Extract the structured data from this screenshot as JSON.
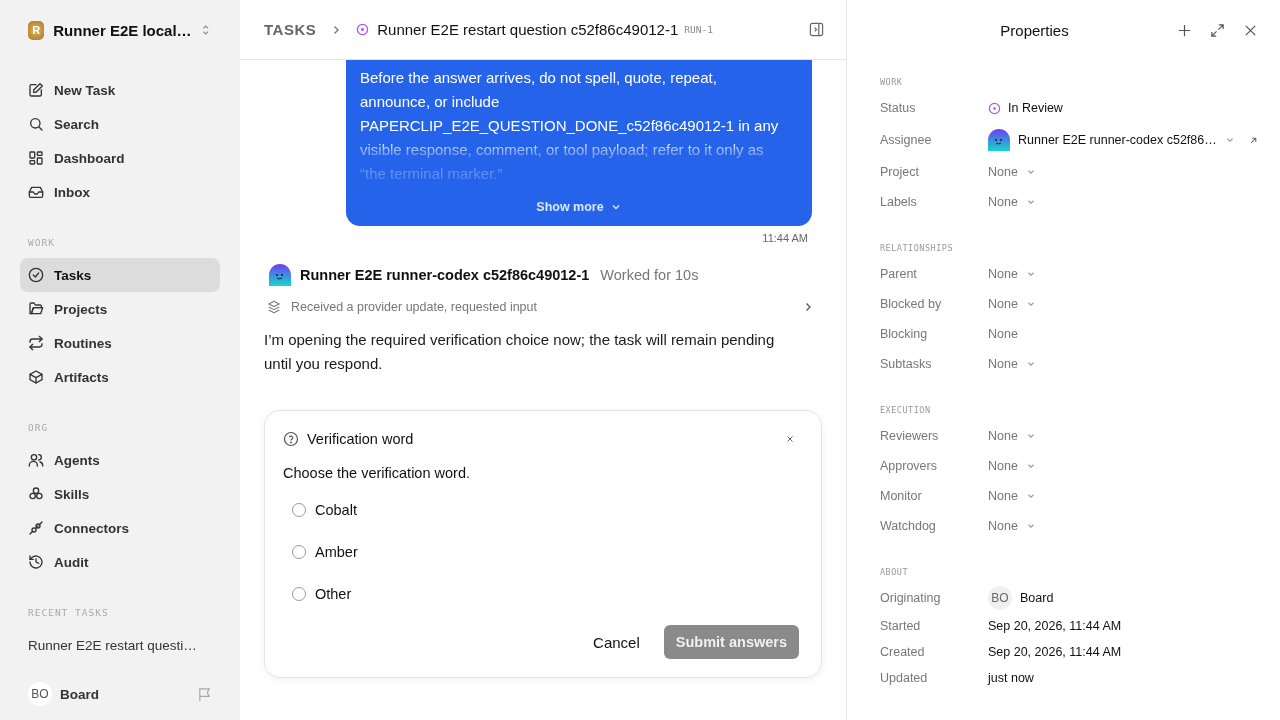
{
  "sidebar": {
    "workspace": {
      "name": "Runner E2E local…",
      "initial": "R"
    },
    "top_items": [
      {
        "label": "New Task",
        "selected": false
      },
      {
        "label": "Search",
        "selected": false
      },
      {
        "label": "Dashboard",
        "selected": false
      },
      {
        "label": "Inbox",
        "selected": false
      }
    ],
    "sections": [
      {
        "title": "WORK",
        "items": [
          {
            "label": "Tasks",
            "selected": true
          },
          {
            "label": "Projects",
            "selected": false
          },
          {
            "label": "Routines",
            "selected": false
          },
          {
            "label": "Artifacts",
            "selected": false
          }
        ]
      },
      {
        "title": "ORG",
        "items": [
          {
            "label": "Agents",
            "selected": false
          },
          {
            "label": "Skills",
            "selected": false
          },
          {
            "label": "Connectors",
            "selected": false
          },
          {
            "label": "Audit",
            "selected": false
          }
        ]
      },
      {
        "title": "RECENT TASKS",
        "items": [
          {
            "label": "Runner E2E restart questi…",
            "selected": false
          }
        ]
      }
    ],
    "user": {
      "initials": "BO",
      "name": "Board"
    }
  },
  "breadcrumb": {
    "root": "TASKS",
    "title": "Runner E2E restart question c52f86c49012-1",
    "run": "RUN-1"
  },
  "message": {
    "text": "Before the answer arrives, do not spell, quote, repeat, announce, or include PAPERCLIP_E2E_QUESTION_DONE_c52f86c49012-1 in any visible response, comment, or tool payload; refer to it only as “the terminal marker.”",
    "show_more": "Show more",
    "time": "11:44 AM"
  },
  "agent_reply": {
    "name": "Runner E2E runner-codex c52f86c49012-1",
    "duration": "Worked for 10s",
    "activity": "Received a provider update, requested input",
    "text": "I’m opening the required verification choice now; the task will remain pending until you respond."
  },
  "question": {
    "title": "Verification word",
    "prompt": "Choose the verification word.",
    "options": [
      {
        "label": "Cobalt",
        "selected": false
      },
      {
        "label": "Amber",
        "selected": false
      },
      {
        "label": "Other",
        "selected": false
      }
    ],
    "cancel": "Cancel",
    "submit": "Submit answers",
    "submit_disabled": true
  },
  "properties": {
    "title": "Properties",
    "sections": [
      {
        "title": "WORK",
        "rows": [
          {
            "label": "Status",
            "value": "In Review",
            "kind": "status"
          },
          {
            "label": "Assignee",
            "value": "Runner E2E runner-codex c52f86…",
            "kind": "agent"
          },
          {
            "label": "Project",
            "value": "None",
            "kind": "select"
          },
          {
            "label": "Labels",
            "value": "None",
            "kind": "select"
          }
        ]
      },
      {
        "title": "RELATIONSHIPS",
        "rows": [
          {
            "label": "Parent",
            "value": "None",
            "kind": "select"
          },
          {
            "label": "Blocked by",
            "value": "None",
            "kind": "select"
          },
          {
            "label": "Blocking",
            "value": "None",
            "kind": "plain"
          },
          {
            "label": "Subtasks",
            "value": "None",
            "kind": "select"
          }
        ]
      },
      {
        "title": "EXECUTION",
        "rows": [
          {
            "label": "Reviewers",
            "value": "None",
            "kind": "select"
          },
          {
            "label": "Approvers",
            "value": "None",
            "kind": "select"
          },
          {
            "label": "Monitor",
            "value": "None",
            "kind": "select"
          },
          {
            "label": "Watchdog",
            "value": "None",
            "kind": "select"
          }
        ]
      },
      {
        "title": "ABOUT",
        "rows": [
          {
            "label": "Originating",
            "value": "Board",
            "initials": "BO",
            "kind": "user"
          },
          {
            "label": "Started",
            "value": "Sep 20, 2026, 11:44 AM",
            "kind": "date"
          },
          {
            "label": "Created",
            "value": "Sep 20, 2026, 11:44 AM",
            "kind": "date"
          },
          {
            "label": "Updated",
            "value": "just now",
            "kind": "date"
          }
        ]
      }
    ]
  }
}
